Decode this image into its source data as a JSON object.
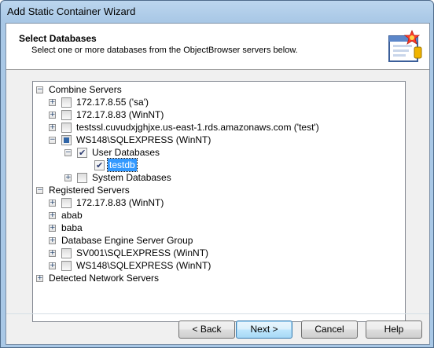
{
  "window": {
    "title": "Add Static Container Wizard"
  },
  "header": {
    "title": "Select Databases",
    "subtitle": "Select one or more databases from the ObjectBrowser servers below."
  },
  "tree": {
    "combine_servers": "Combine Servers",
    "cs_items": [
      "172.17.8.55 ('sa')",
      "172.17.8.83 (WinNT)",
      "testssl.cuvudxjghjxe.us-east-1.rds.amazonaws.com ('test')",
      "WS148\\SQLEXPRESS (WinNT)"
    ],
    "user_databases": "User Databases",
    "testdb": "testdb",
    "system_databases": "System Databases",
    "registered_servers": "Registered Servers",
    "rs_items": [
      "172.17.8.83 (WinNT)",
      "abab",
      "baba",
      "Database Engine Server Group",
      "SV001\\SQLEXPRESS (WinNT)",
      "WS148\\SQLEXPRESS (WinNT)"
    ],
    "detected_network_servers": "Detected Network Servers"
  },
  "buttons": {
    "back": "< Back",
    "next": "Next >",
    "cancel": "Cancel",
    "help": "Help"
  }
}
